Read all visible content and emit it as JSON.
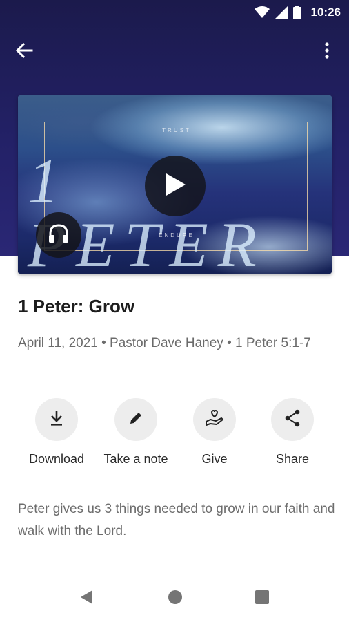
{
  "status_bar": {
    "time": "10:26",
    "icons": [
      "wifi-icon",
      "signal-icon",
      "battery-icon"
    ]
  },
  "app_bar": {
    "back_icon": "arrow-left-icon",
    "menu_icon": "more-vertical-icon"
  },
  "artwork": {
    "title_text": "1 PETER",
    "small_top_text": "TRUST",
    "small_bottom_text": "ENDURE",
    "play_icon": "play-icon",
    "audio_icon": "headphones-icon"
  },
  "sermon": {
    "title": "1 Peter: Grow",
    "meta": "April 11, 2021 • Pastor Dave Haney • 1 Peter 5:1-7",
    "description": "Peter gives us 3 things needed to grow in our faith and walk with the Lord."
  },
  "actions": [
    {
      "label": "Download",
      "icon": "download-icon"
    },
    {
      "label": "Take a note",
      "icon": "pencil-icon"
    },
    {
      "label": "Give",
      "icon": "give-hand-heart-icon"
    },
    {
      "label": "Share",
      "icon": "share-icon"
    }
  ],
  "nav_bar": {
    "icons": [
      "nav-back-icon",
      "nav-home-icon",
      "nav-recents-icon"
    ]
  },
  "colors": {
    "header_background": "#232167",
    "action_circle": "#ededed",
    "title_text": "#1d1d1d",
    "meta_text": "#6b6b6b"
  }
}
